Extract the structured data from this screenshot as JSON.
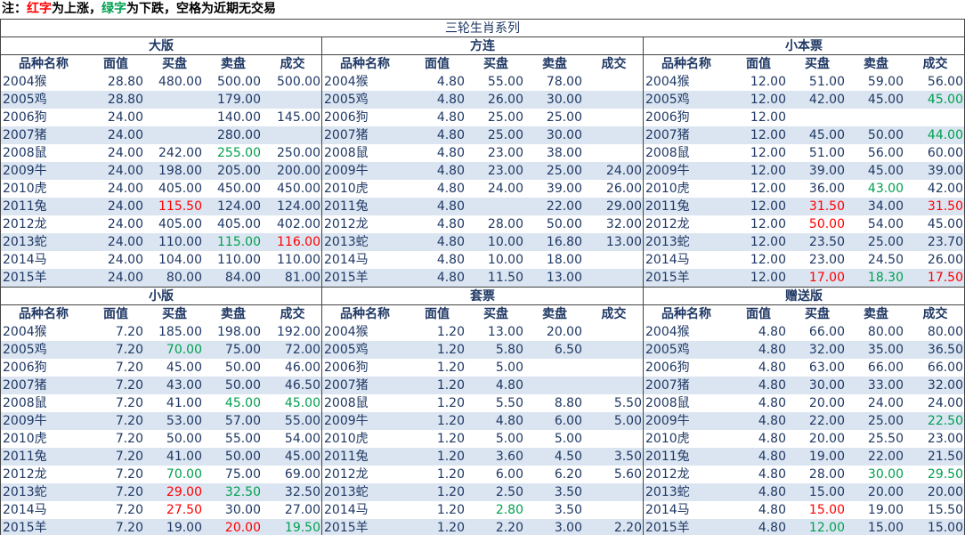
{
  "note": {
    "prefix": "注：",
    "red_word": "红字",
    "mid1": "为上涨，",
    "green_word": "绿字",
    "mid2": "为下跌，空格为近期无交易"
  },
  "title": "三轮生肖系列",
  "headers": [
    "品种名称",
    "面值",
    "买盘",
    "卖盘",
    "成交"
  ],
  "colors": {
    "up": "#ff0000",
    "down": "#00a050",
    "text": "#1f3864",
    "stripe": "#dbe5f1"
  },
  "sections": [
    {
      "title": "大版",
      "rows": [
        {
          "name": "2004猴",
          "face": "28.80",
          "buy": "480.00",
          "sell": "500.00",
          "deal": "500.00"
        },
        {
          "name": "2005鸡",
          "face": "28.80",
          "buy": "",
          "sell": "179.00",
          "deal": ""
        },
        {
          "name": "2006狗",
          "face": "24.00",
          "buy": "",
          "sell": "140.00",
          "deal": "145.00"
        },
        {
          "name": "2007猪",
          "face": "24.00",
          "buy": "",
          "sell": "280.00",
          "deal": ""
        },
        {
          "name": "2008鼠",
          "face": "24.00",
          "buy": "242.00",
          "sell": "255.00",
          "deal": "250.00",
          "sell_c": "green"
        },
        {
          "name": "2009牛",
          "face": "24.00",
          "buy": "198.00",
          "sell": "205.00",
          "deal": "200.00"
        },
        {
          "name": "2010虎",
          "face": "24.00",
          "buy": "405.00",
          "sell": "450.00",
          "deal": "450.00"
        },
        {
          "name": "2011兔",
          "face": "24.00",
          "buy": "115.50",
          "sell": "124.00",
          "deal": "124.00",
          "buy_c": "red"
        },
        {
          "name": "2012龙",
          "face": "24.00",
          "buy": "405.00",
          "sell": "405.00",
          "deal": "402.00"
        },
        {
          "name": "2013蛇",
          "face": "24.00",
          "buy": "110.00",
          "sell": "115.00",
          "deal": "116.00",
          "sell_c": "green",
          "deal_c": "red"
        },
        {
          "name": "2014马",
          "face": "24.00",
          "buy": "104.00",
          "sell": "110.00",
          "deal": "110.00"
        },
        {
          "name": "2015羊",
          "face": "24.00",
          "buy": "80.00",
          "sell": "84.00",
          "deal": "81.00"
        }
      ]
    },
    {
      "title": "方连",
      "rows": [
        {
          "name": "2004猴",
          "face": "4.80",
          "buy": "55.00",
          "sell": "78.00",
          "deal": ""
        },
        {
          "name": "2005鸡",
          "face": "4.80",
          "buy": "26.00",
          "sell": "30.00",
          "deal": ""
        },
        {
          "name": "2006狗",
          "face": "4.80",
          "buy": "25.00",
          "sell": "25.00",
          "deal": ""
        },
        {
          "name": "2007猪",
          "face": "4.80",
          "buy": "25.00",
          "sell": "30.00",
          "deal": ""
        },
        {
          "name": "2008鼠",
          "face": "4.80",
          "buy": "23.00",
          "sell": "38.00",
          "deal": ""
        },
        {
          "name": "2009牛",
          "face": "4.80",
          "buy": "23.00",
          "sell": "25.00",
          "deal": "24.00"
        },
        {
          "name": "2010虎",
          "face": "4.80",
          "buy": "24.00",
          "sell": "39.00",
          "deal": "26.00"
        },
        {
          "name": "2011兔",
          "face": "4.80",
          "buy": "",
          "sell": "22.00",
          "deal": "29.00"
        },
        {
          "name": "2012龙",
          "face": "4.80",
          "buy": "28.00",
          "sell": "50.00",
          "deal": "32.00"
        },
        {
          "name": "2013蛇",
          "face": "4.80",
          "buy": "10.00",
          "sell": "16.80",
          "deal": "13.00"
        },
        {
          "name": "2014马",
          "face": "4.80",
          "buy": "10.00",
          "sell": "18.00",
          "deal": ""
        },
        {
          "name": "2015羊",
          "face": "4.80",
          "buy": "11.50",
          "sell": "13.00",
          "deal": ""
        }
      ]
    },
    {
      "title": "小本票",
      "rows": [
        {
          "name": "2004猴",
          "face": "12.00",
          "buy": "51.00",
          "sell": "59.00",
          "deal": "56.00"
        },
        {
          "name": "2005鸡",
          "face": "12.00",
          "buy": "42.00",
          "sell": "45.00",
          "deal": "45.00",
          "deal_c": "green"
        },
        {
          "name": "2006狗",
          "face": "12.00",
          "buy": "",
          "sell": "",
          "deal": ""
        },
        {
          "name": "2007猪",
          "face": "12.00",
          "buy": "45.00",
          "sell": "50.00",
          "deal": "44.00",
          "deal_c": "green"
        },
        {
          "name": "2008鼠",
          "face": "12.00",
          "buy": "51.00",
          "sell": "56.00",
          "deal": "60.00"
        },
        {
          "name": "2009牛",
          "face": "12.00",
          "buy": "39.00",
          "sell": "45.00",
          "deal": "39.00"
        },
        {
          "name": "2010虎",
          "face": "12.00",
          "buy": "36.00",
          "sell": "43.00",
          "deal": "42.00",
          "sell_c": "green"
        },
        {
          "name": "2011兔",
          "face": "12.00",
          "buy": "31.50",
          "sell": "34.00",
          "deal": "31.50",
          "buy_c": "red",
          "deal_c": "red"
        },
        {
          "name": "2012龙",
          "face": "12.00",
          "buy": "50.00",
          "sell": "54.00",
          "deal": "45.00",
          "buy_c": "red"
        },
        {
          "name": "2013蛇",
          "face": "12.00",
          "buy": "23.50",
          "sell": "25.00",
          "deal": "23.70"
        },
        {
          "name": "2014马",
          "face": "12.00",
          "buy": "23.00",
          "sell": "24.50",
          "deal": "26.00"
        },
        {
          "name": "2015羊",
          "face": "12.00",
          "buy": "17.00",
          "sell": "18.30",
          "deal": "17.50",
          "buy_c": "red",
          "sell_c": "green",
          "deal_c": "red"
        }
      ]
    },
    {
      "title": "小版",
      "rows": [
        {
          "name": "2004猴",
          "face": "7.20",
          "buy": "185.00",
          "sell": "198.00",
          "deal": "192.00"
        },
        {
          "name": "2005鸡",
          "face": "7.20",
          "buy": "70.00",
          "sell": "75.00",
          "deal": "72.00",
          "buy_c": "green"
        },
        {
          "name": "2006狗",
          "face": "7.20",
          "buy": "45.00",
          "sell": "50.00",
          "deal": "46.00"
        },
        {
          "name": "2007猪",
          "face": "7.20",
          "buy": "43.00",
          "sell": "50.00",
          "deal": "46.50"
        },
        {
          "name": "2008鼠",
          "face": "7.20",
          "buy": "41.00",
          "sell": "45.00",
          "deal": "45.00",
          "sell_c": "green",
          "deal_c": "green"
        },
        {
          "name": "2009牛",
          "face": "7.20",
          "buy": "53.00",
          "sell": "57.00",
          "deal": "55.00"
        },
        {
          "name": "2010虎",
          "face": "7.20",
          "buy": "50.00",
          "sell": "55.00",
          "deal": "54.00"
        },
        {
          "name": "2011兔",
          "face": "7.20",
          "buy": "41.00",
          "sell": "50.00",
          "deal": "45.00"
        },
        {
          "name": "2012龙",
          "face": "7.20",
          "buy": "70.00",
          "sell": "75.00",
          "deal": "69.00",
          "buy_c": "green"
        },
        {
          "name": "2013蛇",
          "face": "7.20",
          "buy": "29.00",
          "sell": "32.50",
          "deal": "32.50",
          "buy_c": "red",
          "sell_c": "green"
        },
        {
          "name": "2014马",
          "face": "7.20",
          "buy": "27.50",
          "sell": "30.00",
          "deal": "27.00",
          "buy_c": "red"
        },
        {
          "name": "2015羊",
          "face": "7.20",
          "buy": "19.00",
          "sell": "20.00",
          "deal": "19.50",
          "sell_c": "red",
          "deal_c": "green"
        }
      ]
    },
    {
      "title": "套票",
      "rows": [
        {
          "name": "2004猴",
          "face": "1.20",
          "buy": "13.00",
          "sell": "20.00",
          "deal": ""
        },
        {
          "name": "2005鸡",
          "face": "1.20",
          "buy": "5.80",
          "sell": "6.50",
          "deal": ""
        },
        {
          "name": "2006狗",
          "face": "1.20",
          "buy": "5.00",
          "sell": "",
          "deal": ""
        },
        {
          "name": "2007猪",
          "face": "1.20",
          "buy": "4.80",
          "sell": "",
          "deal": ""
        },
        {
          "name": "2008鼠",
          "face": "1.20",
          "buy": "5.50",
          "sell": "8.80",
          "deal": "5.50"
        },
        {
          "name": "2009牛",
          "face": "1.20",
          "buy": "4.80",
          "sell": "6.00",
          "deal": "5.00"
        },
        {
          "name": "2010虎",
          "face": "1.20",
          "buy": "5.00",
          "sell": "5.00",
          "deal": ""
        },
        {
          "name": "2011兔",
          "face": "1.20",
          "buy": "3.60",
          "sell": "4.50",
          "deal": "3.50"
        },
        {
          "name": "2012龙",
          "face": "1.20",
          "buy": "6.00",
          "sell": "6.20",
          "deal": "5.60"
        },
        {
          "name": "2013蛇",
          "face": "1.20",
          "buy": "2.50",
          "sell": "3.50",
          "deal": ""
        },
        {
          "name": "2014马",
          "face": "1.20",
          "buy": "2.80",
          "sell": "3.50",
          "deal": "",
          "buy_c": "green"
        },
        {
          "name": "2015羊",
          "face": "1.20",
          "buy": "2.20",
          "sell": "3.00",
          "deal": "2.20"
        }
      ]
    },
    {
      "title": "赠送版",
      "rows": [
        {
          "name": "2004猴",
          "face": "4.80",
          "buy": "66.00",
          "sell": "80.00",
          "deal": "80.00"
        },
        {
          "name": "2005鸡",
          "face": "4.80",
          "buy": "32.00",
          "sell": "35.00",
          "deal": "36.50"
        },
        {
          "name": "2006狗",
          "face": "4.80",
          "buy": "63.00",
          "sell": "66.00",
          "deal": "66.00"
        },
        {
          "name": "2007猪",
          "face": "4.80",
          "buy": "30.00",
          "sell": "33.00",
          "deal": "32.00"
        },
        {
          "name": "2008鼠",
          "face": "4.80",
          "buy": "20.00",
          "sell": "24.00",
          "deal": "24.00"
        },
        {
          "name": "2009牛",
          "face": "4.80",
          "buy": "22.00",
          "sell": "25.00",
          "deal": "22.50",
          "deal_c": "green"
        },
        {
          "name": "2010虎",
          "face": "4.80",
          "buy": "20.00",
          "sell": "25.50",
          "deal": "23.00"
        },
        {
          "name": "2011兔",
          "face": "4.80",
          "buy": "19.00",
          "sell": "22.00",
          "deal": "21.50"
        },
        {
          "name": "2012龙",
          "face": "4.80",
          "buy": "28.00",
          "sell": "30.00",
          "deal": "29.50",
          "sell_c": "green",
          "deal_c": "green"
        },
        {
          "name": "2013蛇",
          "face": "4.80",
          "buy": "15.00",
          "sell": "20.00",
          "deal": "20.00"
        },
        {
          "name": "2014马",
          "face": "4.80",
          "buy": "15.00",
          "sell": "19.00",
          "deal": "15.50",
          "buy_c": "red"
        },
        {
          "name": "2015羊",
          "face": "4.80",
          "buy": "12.00",
          "sell": "15.00",
          "deal": "15.00",
          "buy_c": "green"
        }
      ]
    }
  ]
}
